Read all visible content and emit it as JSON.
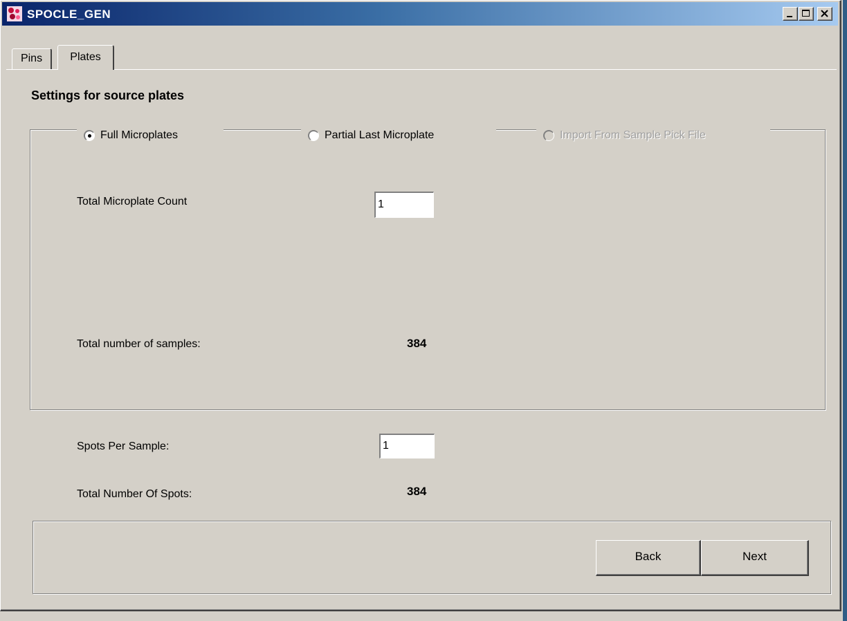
{
  "window": {
    "title": "SPOCLE_GEN",
    "app_icon": "app-logo-icon",
    "controls": [
      "minimize-icon",
      "maximize-icon",
      "close-icon"
    ]
  },
  "tabs": [
    {
      "label": "Pins",
      "active": false
    },
    {
      "label": "Plates",
      "active": true
    }
  ],
  "main": {
    "heading": "Settings for source plates",
    "source_options": [
      {
        "label": "Full Microplates",
        "selected": true,
        "enabled": true
      },
      {
        "label": "Partial Last Microplate",
        "selected": false,
        "enabled": true
      },
      {
        "label": "Import From Sample Pick File",
        "selected": false,
        "enabled": false
      }
    ],
    "microplate_count_label": "Total Microplate Count",
    "microplate_count_value": "1",
    "total_samples_label": "Total number of samples:",
    "total_samples_value": "384",
    "spots_per_sample_label": "Spots Per Sample:",
    "spots_per_sample_value": "1",
    "total_spots_label": "Total Number Of Spots:",
    "total_spots_value": "384"
  },
  "buttons": {
    "back": "Back",
    "next": "Next"
  },
  "colors": {
    "title_gradient_start": "#0a246a",
    "title_gradient_end": "#a6caf0",
    "face": "#d4d0c8",
    "disabled_text": "#a0a0a0"
  }
}
